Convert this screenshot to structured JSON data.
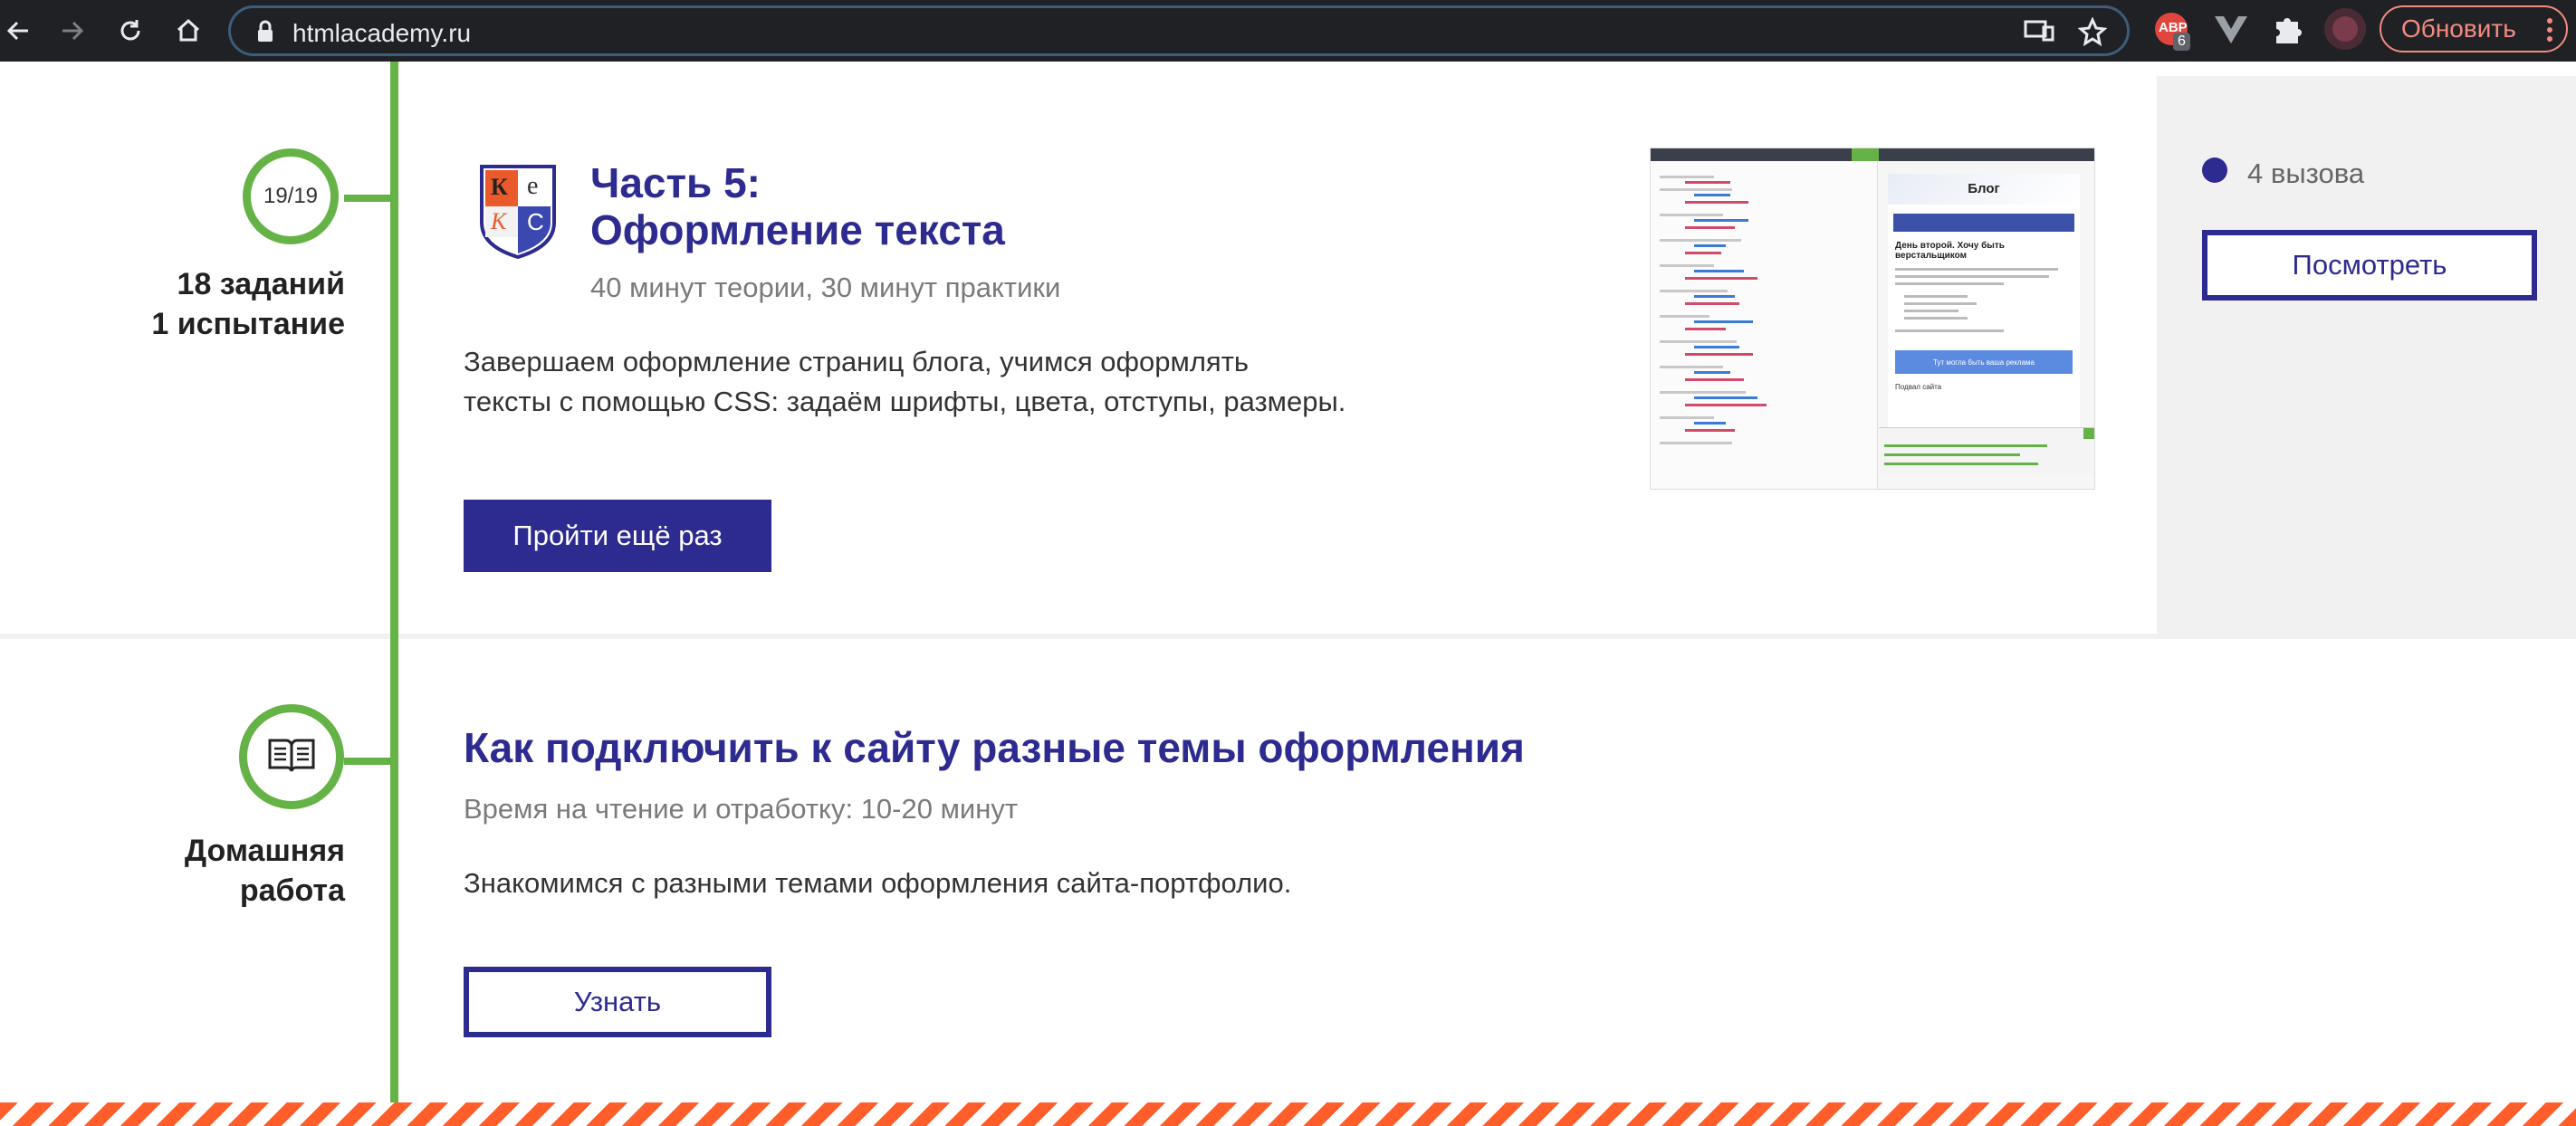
{
  "browser": {
    "url": "htmlacademy.ru",
    "extension_badge": "ABP",
    "extension_count": "6",
    "update_label": "Обновить"
  },
  "part5": {
    "progress": "19/19",
    "tasks": "18 заданий",
    "trials": "1 испытание",
    "logo_letters": [
      "К",
      "е",
      "К",
      "С"
    ],
    "title_line1": "Часть 5:",
    "title_line2": "Оформление текста",
    "meta": "40 минут теории, 30 минут практики",
    "desc_line1": "Завершаем оформление страниц блога, учимся оформлять",
    "desc_line2": "тексты с помощью CSS: задаём шрифты, цвета, отступы, размеры.",
    "button": "Пройти ещё раз",
    "challenges": "4 вызова",
    "view_button": "Посмотреть",
    "thumb": {
      "blog_title": "Блог",
      "heading": "День второй. Хочу быть верстальщиком",
      "cta": "Тут могла быть ваша реклама",
      "footer": "Подвал сайта"
    }
  },
  "homework": {
    "label_line1": "Домашняя",
    "label_line2": "работа",
    "title": "Как подключить к сайту разные темы оформления",
    "meta": "Время на чтение и отработку: 10-20 минут",
    "desc": "Знакомимся с разными темами оформления сайта-портфолио.",
    "button": "Узнать"
  },
  "colors": {
    "brand": "#2d2b8f",
    "timeline": "#65b346",
    "stripe": "#ff5e2b"
  }
}
